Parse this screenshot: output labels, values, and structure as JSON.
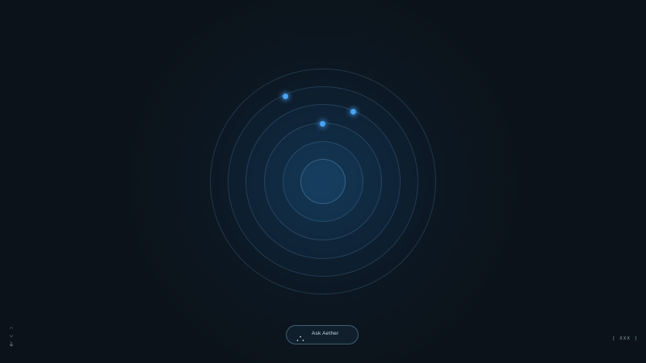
{
  "app": {
    "name": "Aether"
  },
  "orb": {
    "ring_count": 6,
    "accent_color": "#4aa3f0",
    "dots": 3
  },
  "ask_button": {
    "label": "Ask Aether",
    "icon": "sparkle-icon"
  },
  "side_nav": {
    "icons": [
      "chevron-up-icon",
      "chevron-down-icon",
      "arrow-down-icon"
    ]
  },
  "corner_label": {
    "text": "[ XXX ]"
  },
  "colors": {
    "background": "#0b1219",
    "ring_stroke": "#6eaad2",
    "dot": "#4aa3f0",
    "button_border": "#78aac8",
    "text": "#c9d6df"
  }
}
